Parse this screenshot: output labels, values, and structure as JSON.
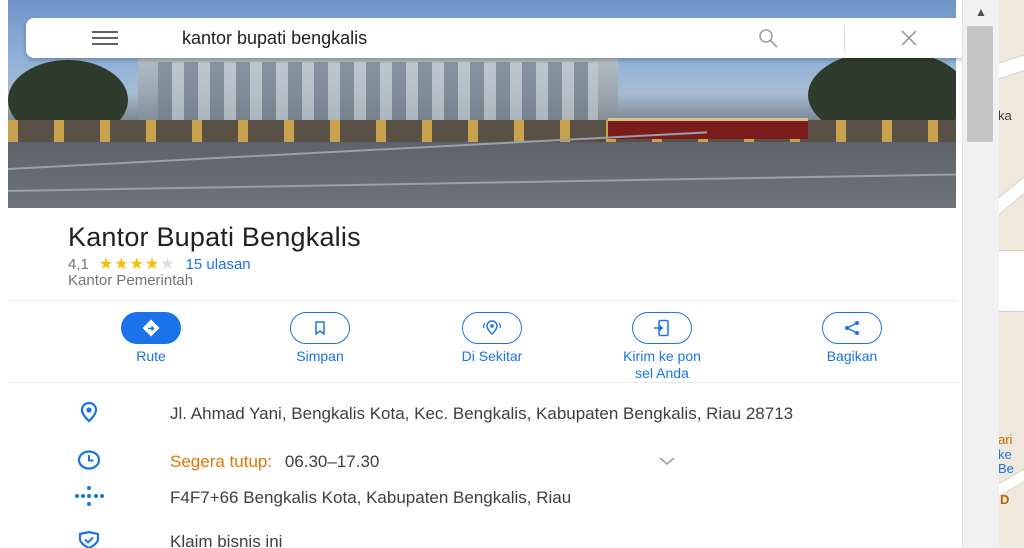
{
  "search": {
    "query": "kantor bupati bengkalis"
  },
  "place": {
    "title": "Kantor Bupati Bengkalis",
    "rating": "4,1",
    "stars_filled": 4,
    "stars_total": 5,
    "stars_filled_text": "★★★★",
    "stars_empty_text": "★",
    "reviews": "15 ulasan",
    "category": "Kantor Pemerintah"
  },
  "actions": [
    {
      "label": "Rute",
      "icon": "directions-icon"
    },
    {
      "label": "Simpan",
      "icon": "bookmark-icon"
    },
    {
      "label": "Di Sekitar",
      "icon": "nearby-icon"
    },
    {
      "label": "Kirim ke pon sel Anda",
      "icon": "send-to-phone-icon"
    },
    {
      "label": "Bagikan",
      "icon": "share-icon"
    }
  ],
  "info": {
    "address": "Jl. Ahmad Yani, Bengkalis Kota, Kec. Bengkalis, Kabupaten Bengkalis, Riau 28713",
    "hours_status": "Segera tutup:",
    "hours": "06.30–17.30",
    "plus_code": "F4F7+66 Bengkalis Kota, Kabupaten Bengkalis, Riau",
    "claim": "Klaim bisnis ini"
  },
  "map_labels": [
    "ka",
    "ari",
    "ke",
    "Be",
    "D"
  ],
  "colors": {
    "accent": "#1a73e8",
    "star": "#fbbc04",
    "closing_soon": "#e37400"
  }
}
